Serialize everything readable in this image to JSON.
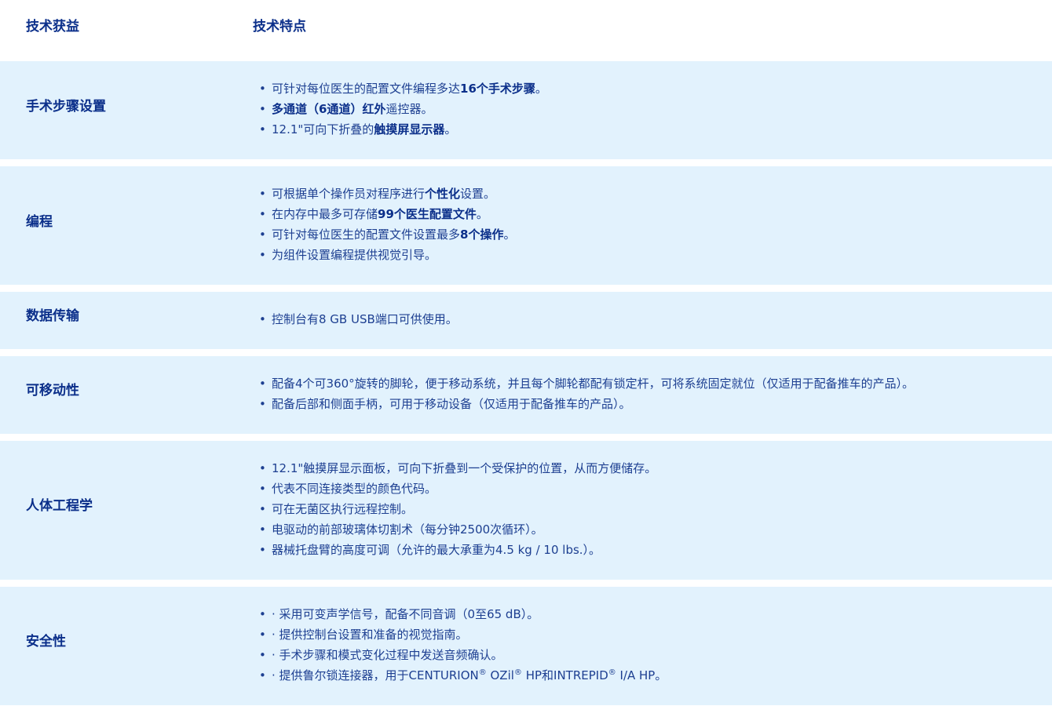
{
  "header": {
    "benefit_label": "技术获益",
    "feature_label": "技术特点"
  },
  "colors": {
    "row_background": "#e2f2fd",
    "text": "#0b2f8a",
    "page_background": "#ffffff"
  },
  "rows": [
    {
      "label": "手术步骤设置",
      "items": [
        [
          {
            "t": "可针对每位医生的配置文件编程多达"
          },
          {
            "t": "16个手术步骤",
            "b": true
          },
          {
            "t": "。"
          }
        ],
        [
          {
            "t": "多通道（6通道）红外",
            "b": true
          },
          {
            "t": "遥控器。"
          }
        ],
        [
          {
            "t": "12.1\"可向下折叠的"
          },
          {
            "t": "触摸屏显示器",
            "b": true
          },
          {
            "t": "。"
          }
        ]
      ]
    },
    {
      "label": "编程",
      "items": [
        [
          {
            "t": "可根据单个操作员对程序进行"
          },
          {
            "t": "个性化",
            "b": true
          },
          {
            "t": "设置。"
          }
        ],
        [
          {
            "t": "在内存中最多可存储"
          },
          {
            "t": "99个医生配置文件",
            "b": true
          },
          {
            "t": "。"
          }
        ],
        [
          {
            "t": "可针对每位医生的配置文件设置最多"
          },
          {
            "t": "8个操作",
            "b": true
          },
          {
            "t": "。"
          }
        ],
        [
          {
            "t": "为组件设置编程提供视觉引导。"
          }
        ]
      ]
    },
    {
      "label": "数据传输",
      "items": [
        [
          {
            "t": "控制台有8 GB USB端口可供使用。"
          }
        ]
      ]
    },
    {
      "label": "可移动性",
      "items": [
        [
          {
            "t": "配备4个可360°旋转的脚轮，便于移动系统，并且每个脚轮都配有锁定杆，可将系统固定就位（仅适用于配备推车的产品）。"
          }
        ],
        [
          {
            "t": "配备后部和侧面手柄，可用于移动设备（仅适用于配备推车的产品）。"
          }
        ]
      ]
    },
    {
      "label": "人体工程学",
      "items": [
        [
          {
            "t": "12.1\"触摸屏显示面板，可向下折叠到一个受保护的位置，从而方便储存。"
          }
        ],
        [
          {
            "t": "代表不同连接类型的颜色代码。"
          }
        ],
        [
          {
            "t": "可在无菌区执行远程控制。"
          }
        ],
        [
          {
            "t": "电驱动的前部玻璃体切割术（每分钟2500次循环）。"
          }
        ],
        [
          {
            "t": "器械托盘臂的高度可调（允许的最大承重为4.5 kg / 10 lbs.）。"
          }
        ]
      ]
    },
    {
      "label": "安全性",
      "items": [
        [
          {
            "t": "· 采用可变声学信号，配备不同音调（0至65 dB）。"
          }
        ],
        [
          {
            "t": "· 提供控制台设置和准备的视觉指南。"
          }
        ],
        [
          {
            "t": "· 手术步骤和模式变化过程中发送音频确认。"
          }
        ],
        [
          {
            "t": "· 提供鲁尔锁连接器，用于CENTURION"
          },
          {
            "t": "®",
            "sup": true
          },
          {
            "t": " OZil"
          },
          {
            "t": "®",
            "sup": true
          },
          {
            "t": " HP和INTREPID"
          },
          {
            "t": "®",
            "sup": true
          },
          {
            "t": " I/A HP。"
          }
        ]
      ]
    }
  ]
}
